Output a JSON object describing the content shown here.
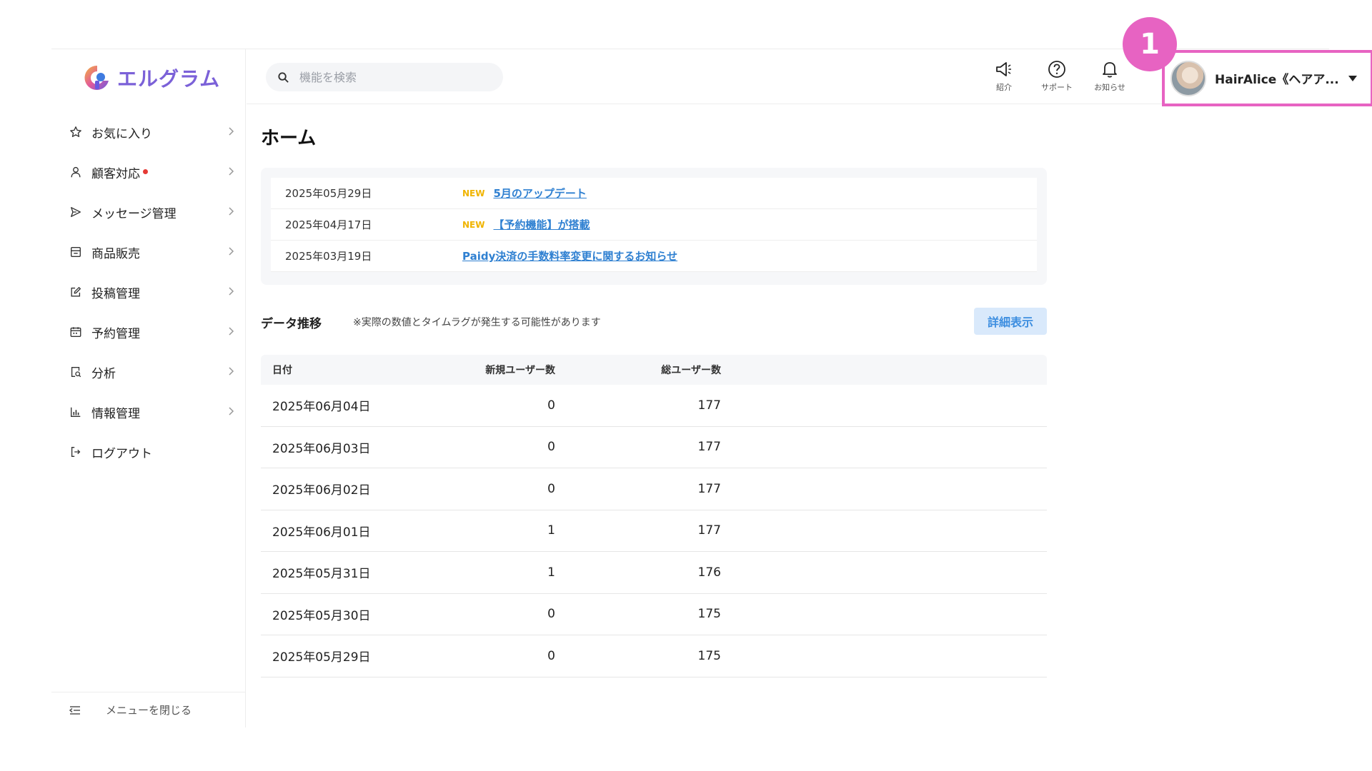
{
  "app": {
    "brand": "エルグラム",
    "badge": "1"
  },
  "sidebar": {
    "items": [
      {
        "label": "お気に入り",
        "icon": "star-icon"
      },
      {
        "label": "顧客対応",
        "icon": "person-icon",
        "dot": true
      },
      {
        "label": "メッセージ管理",
        "icon": "send-icon"
      },
      {
        "label": "商品販売",
        "icon": "store-icon"
      },
      {
        "label": "投稿管理",
        "icon": "edit-icon"
      },
      {
        "label": "予約管理",
        "icon": "calendar-icon"
      },
      {
        "label": "分析",
        "icon": "report-icon"
      },
      {
        "label": "情報管理",
        "icon": "bar-chart-icon"
      },
      {
        "label": "ログアウト",
        "icon": "logout-icon"
      }
    ],
    "close_label": "メニューを閉じる"
  },
  "header": {
    "search_placeholder": "機能を検索",
    "buttons": [
      {
        "label": "紹介",
        "icon": "megaphone-icon"
      },
      {
        "label": "サポート",
        "icon": "help-circle-icon"
      },
      {
        "label": "お知らせ",
        "icon": "bell-icon"
      }
    ],
    "user_name": "HairAlice《ヘアア..."
  },
  "main": {
    "page_title": "ホーム",
    "news": [
      {
        "date": "2025年05月29日",
        "new": "NEW",
        "title": "5月のアップデート"
      },
      {
        "date": "2025年04月17日",
        "new": "NEW",
        "title": "【予約機能】が搭載"
      },
      {
        "date": "2025年03月19日",
        "new": "",
        "title": "Paidy決済の手数料率変更に関するお知らせ"
      }
    ],
    "data_title": "データ推移",
    "data_note": "※実際の数値とタイムラグが発生する可能性があります",
    "detail_button": "詳細表示",
    "table": {
      "headers": [
        "日付",
        "新規ユーザー数",
        "総ユーザー数"
      ],
      "rows": [
        [
          "2025年06月04日",
          "0",
          "177"
        ],
        [
          "2025年06月03日",
          "0",
          "177"
        ],
        [
          "2025年06月02日",
          "0",
          "177"
        ],
        [
          "2025年06月01日",
          "1",
          "177"
        ],
        [
          "2025年05月31日",
          "1",
          "176"
        ],
        [
          "2025年05月30日",
          "0",
          "175"
        ],
        [
          "2025年05月29日",
          "0",
          "175"
        ]
      ]
    }
  },
  "colors": {
    "accent_purple": "#7b61d8",
    "highlight_pink": "#e763c2",
    "link_blue": "#2f80d1",
    "new_yellow": "#f0b400",
    "notify_red": "#e53935"
  }
}
